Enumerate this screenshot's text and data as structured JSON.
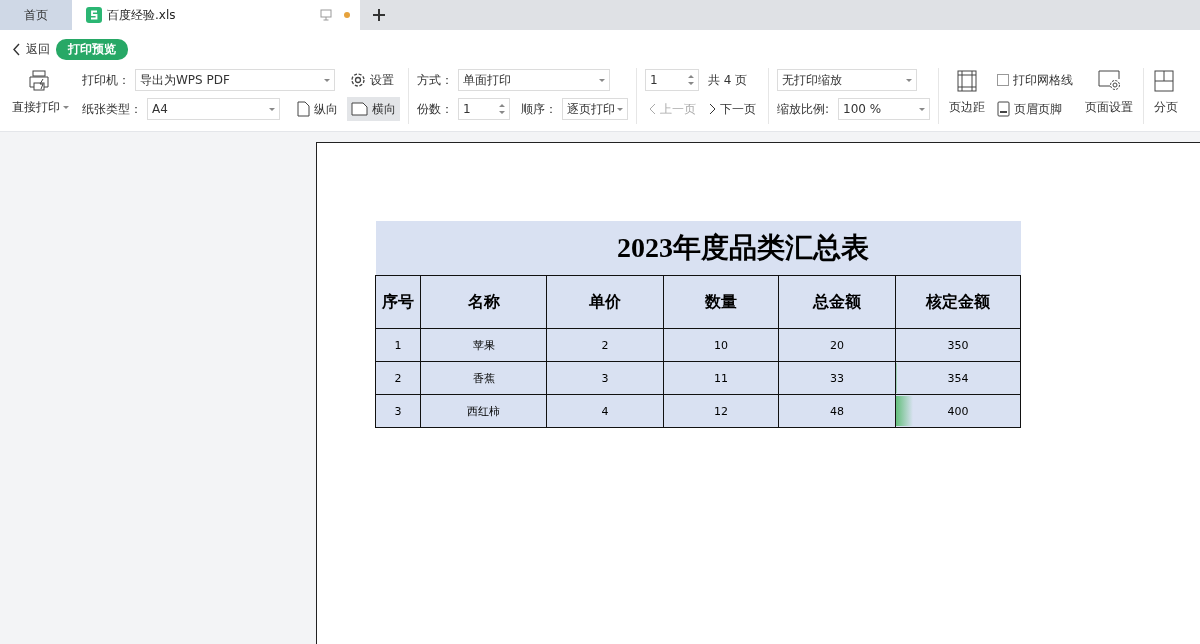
{
  "tabs": [
    {
      "kind": "home",
      "label": "首页",
      "selected": false
    },
    {
      "kind": "file",
      "label": "百度经验.xls",
      "selected": true,
      "modified": true
    }
  ],
  "header": {
    "back": "返回",
    "mode_badge": "打印预览"
  },
  "toolbar": {
    "direct_print": "直接打印",
    "printer": {
      "label": "打印机：",
      "value": "导出为WPS PDF"
    },
    "settings": "设置",
    "paper": {
      "label": "纸张类型：",
      "value": "A4"
    },
    "orientation": [
      {
        "label": "纵向",
        "selected": false
      },
      {
        "label": "横向",
        "selected": true
      }
    ],
    "mode": {
      "label": "方式：",
      "value": "单面打印"
    },
    "copies": {
      "label": "份数：",
      "value": "1"
    },
    "order": {
      "label": "顺序：",
      "value": "逐页打印"
    },
    "page": {
      "value": "1",
      "total": "共 4 页"
    },
    "prev": {
      "label": "上一页",
      "disabled": true
    },
    "next": {
      "label": "下一页",
      "disabled": false
    },
    "scaling": {
      "value": "无打印缩放"
    },
    "zoom": {
      "label": "缩放比例:",
      "value": "100 %"
    },
    "margins": "页边距",
    "gridlines": {
      "label": "打印网格线",
      "checked": false
    },
    "header_footer": "页眉页脚",
    "page_setup": "页面设置",
    "page_break": "分页"
  },
  "sheet": {
    "title": "2023年度品类汇总表",
    "columns": [
      "序号",
      "名称",
      "单价",
      "数量",
      "总金额",
      "核定金额"
    ],
    "rows": [
      {
        "cells": [
          "1",
          "苹果",
          "2",
          "10",
          "20",
          "350"
        ]
      },
      {
        "cells": [
          "2",
          "香蕉",
          "3",
          "11",
          "33",
          "354"
        ],
        "level": 0.01
      },
      {
        "cells": [
          "3",
          "西红柿",
          "4",
          "12",
          "48",
          "400"
        ],
        "level": 0.14
      }
    ]
  }
}
